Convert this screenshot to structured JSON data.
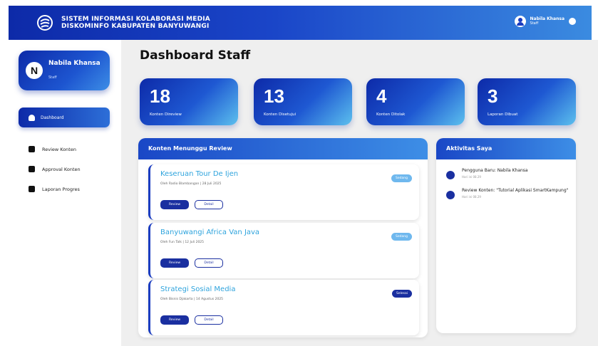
{
  "header": {
    "title_line1": "SISTEM INFORMASI KOLABORASI MEDIA",
    "title_line2": "DISKOMINFO KABUPATEN BANYUWANGI",
    "user_name": "Nabila Khansa",
    "user_role": "Staff"
  },
  "sidebar": {
    "profile": {
      "initial": "N",
      "name": "Nabila Khansa",
      "role": "Staff"
    },
    "items": [
      {
        "label": "Dashboard",
        "icon": "home-icon",
        "active": true
      },
      {
        "label": "Review Konten",
        "icon": "clipboard-icon"
      },
      {
        "label": "Approval Konten",
        "icon": "check-icon"
      },
      {
        "label": "Laporan Progres",
        "icon": "report-icon"
      }
    ]
  },
  "main": {
    "page_title": "Dashboard Staff",
    "stats": [
      {
        "value": "18",
        "label": "Konten Direview"
      },
      {
        "value": "13",
        "label": "Konten Disetujui"
      },
      {
        "value": "4",
        "label": "Konten Ditolak"
      },
      {
        "value": "3",
        "label": "Laporan Dibuat"
      }
    ],
    "review_panel": {
      "title": "Konten Menunggu Review",
      "items": [
        {
          "title": "Keseruan Tour De Ijen",
          "meta": "Oleh Radio Blambangan | 28 Juli 2025",
          "badge": "Sedang",
          "review": "Review",
          "detail": "Detail"
        },
        {
          "title": "Banyuwangi Africa Van Java",
          "meta": "Oleh Fun Talk | 12 Juli 2025",
          "badge": "Sedang",
          "review": "Review",
          "detail": "Detail"
        },
        {
          "title": "Strategi Sosial Media",
          "meta": "Oleh Bisnis Djakarta | 14 Agustus 2025",
          "badge": "Selesai",
          "review": "Review",
          "detail": "Detail"
        }
      ]
    },
    "activity_panel": {
      "title": "Aktivitas Saya",
      "items": [
        {
          "text": "Pengguna Baru: Nabila Khansa",
          "time": "Hari ini 08.29"
        },
        {
          "text": "Review Konten: \"Tutorial Aplikasi SmartKampung\"",
          "time": "Hari ini 08.29"
        }
      ]
    }
  },
  "colors": {
    "primary": "#0d2aa8",
    "accent": "#3d8ee6",
    "title_blue": "#2fa4dd",
    "background": "#efefef"
  }
}
